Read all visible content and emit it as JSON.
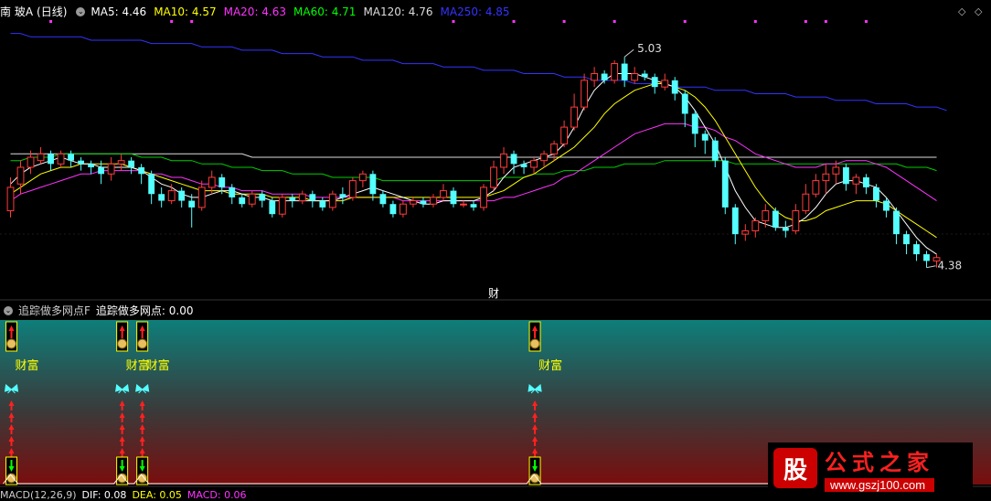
{
  "header": {
    "stock": "南 玻A",
    "period": "(日线)",
    "mas": [
      {
        "label": "MA5: 4.46",
        "color": "#ffffff"
      },
      {
        "label": "MA10: 4.57",
        "color": "#ffff00"
      },
      {
        "label": "MA20: 4.63",
        "color": "#ff33ff"
      },
      {
        "label": "MA60: 4.71",
        "color": "#00ff00"
      },
      {
        "label": "MA120: 4.76",
        "color": "#dddddd"
      },
      {
        "label": "MA250: 4.85",
        "color": "#3333ff"
      }
    ]
  },
  "indicator": {
    "name": "追踪做多网点F",
    "value_label": "追踪做多网点: 0.00",
    "signal_text": "财富"
  },
  "macd": {
    "label": "MACD(12,26,9)",
    "dif": "DIF: 0.08",
    "dea": "DEA: 0.05",
    "macd": "MACD: 0.06"
  },
  "chart_data": {
    "type": "candlestick",
    "annotations": {
      "high": "5.03",
      "low": "4.38",
      "event_marker": "财"
    },
    "y_range": [
      4.3,
      5.12
    ],
    "candles": [
      [
        4.55,
        4.62,
        4.53,
        4.65
      ],
      [
        4.63,
        4.68,
        4.6,
        4.7
      ],
      [
        4.68,
        4.71,
        4.66,
        4.73
      ],
      [
        4.7,
        4.72,
        4.69,
        4.74
      ],
      [
        4.72,
        4.69,
        4.67,
        4.73
      ],
      [
        4.69,
        4.72,
        4.68,
        4.73
      ],
      [
        4.72,
        4.7,
        4.68,
        4.73
      ],
      [
        4.7,
        4.69,
        4.67,
        4.71
      ],
      [
        4.69,
        4.68,
        4.66,
        4.7
      ],
      [
        4.68,
        4.66,
        4.63,
        4.7
      ],
      [
        4.66,
        4.69,
        4.64,
        4.71
      ],
      [
        4.69,
        4.7,
        4.67,
        4.72
      ],
      [
        4.7,
        4.68,
        4.66,
        4.71
      ],
      [
        4.68,
        4.66,
        4.63,
        4.69
      ],
      [
        4.66,
        4.6,
        4.57,
        4.67
      ],
      [
        4.6,
        4.58,
        4.56,
        4.62
      ],
      [
        4.58,
        4.61,
        4.57,
        4.63
      ],
      [
        4.61,
        4.58,
        4.56,
        4.62
      ],
      [
        4.58,
        4.56,
        4.5,
        4.6
      ],
      [
        4.56,
        4.62,
        4.55,
        4.64
      ],
      [
        4.62,
        4.65,
        4.6,
        4.67
      ],
      [
        4.65,
        4.62,
        4.6,
        4.66
      ],
      [
        4.62,
        4.59,
        4.57,
        4.63
      ],
      [
        4.59,
        4.57,
        4.56,
        4.6
      ],
      [
        4.57,
        4.6,
        4.56,
        4.61
      ],
      [
        4.6,
        4.58,
        4.56,
        4.61
      ],
      [
        4.58,
        4.54,
        4.53,
        4.59
      ],
      [
        4.54,
        4.59,
        4.53,
        4.6
      ],
      [
        4.59,
        4.58,
        4.56,
        4.6
      ],
      [
        4.58,
        4.6,
        4.57,
        4.61
      ],
      [
        4.6,
        4.58,
        4.56,
        4.61
      ],
      [
        4.58,
        4.56,
        4.55,
        4.59
      ],
      [
        4.56,
        4.6,
        4.55,
        4.61
      ],
      [
        4.6,
        4.59,
        4.57,
        4.62
      ],
      [
        4.59,
        4.64,
        4.58,
        4.65
      ],
      [
        4.64,
        4.66,
        4.62,
        4.67
      ],
      [
        4.66,
        4.6,
        4.58,
        4.67
      ],
      [
        4.6,
        4.57,
        4.56,
        4.61
      ],
      [
        4.57,
        4.54,
        4.53,
        4.58
      ],
      [
        4.54,
        4.57,
        4.53,
        4.58
      ],
      [
        4.57,
        4.58,
        4.56,
        4.59
      ],
      [
        4.58,
        4.57,
        4.56,
        4.59
      ],
      [
        4.57,
        4.59,
        4.56,
        4.6
      ],
      [
        4.59,
        4.61,
        4.58,
        4.63
      ],
      [
        4.61,
        4.57,
        4.56,
        4.62
      ],
      [
        4.57,
        4.57,
        4.56,
        4.58
      ],
      [
        4.57,
        4.56,
        4.55,
        4.58
      ],
      [
        4.56,
        4.62,
        4.55,
        4.63
      ],
      [
        4.62,
        4.68,
        4.61,
        4.7
      ],
      [
        4.68,
        4.72,
        4.66,
        4.74
      ],
      [
        4.72,
        4.69,
        4.66,
        4.73
      ],
      [
        4.69,
        4.68,
        4.66,
        4.7
      ],
      [
        4.68,
        4.7,
        4.66,
        4.71
      ],
      [
        4.7,
        4.72,
        4.68,
        4.73
      ],
      [
        4.72,
        4.75,
        4.7,
        4.76
      ],
      [
        4.75,
        4.8,
        4.74,
        4.82
      ],
      [
        4.8,
        4.86,
        4.79,
        4.9
      ],
      [
        4.86,
        4.94,
        4.85,
        4.96
      ],
      [
        4.94,
        4.96,
        4.92,
        4.98
      ],
      [
        4.96,
        4.94,
        4.93,
        4.97
      ],
      [
        4.94,
        4.99,
        4.93,
        5.0
      ],
      [
        4.99,
        4.94,
        4.92,
        5.01
      ],
      [
        4.94,
        4.96,
        4.93,
        4.98
      ],
      [
        4.96,
        4.95,
        4.94,
        4.97
      ],
      [
        4.95,
        4.92,
        4.9,
        4.96
      ],
      [
        4.92,
        4.94,
        4.91,
        4.96
      ],
      [
        4.94,
        4.9,
        4.88,
        4.95
      ],
      [
        4.9,
        4.84,
        4.8,
        4.91
      ],
      [
        4.84,
        4.78,
        4.74,
        4.85
      ],
      [
        4.78,
        4.76,
        4.72,
        4.79
      ],
      [
        4.76,
        4.7,
        4.68,
        4.77
      ],
      [
        4.7,
        4.56,
        4.54,
        4.71
      ],
      [
        4.56,
        4.48,
        4.45,
        4.57
      ],
      [
        4.48,
        4.49,
        4.46,
        4.51
      ],
      [
        4.49,
        4.52,
        4.47,
        4.53
      ],
      [
        4.52,
        4.55,
        4.5,
        4.57
      ],
      [
        4.55,
        4.5,
        4.49,
        4.56
      ],
      [
        4.5,
        4.49,
        4.47,
        4.52
      ],
      [
        4.49,
        4.55,
        4.48,
        4.57
      ],
      [
        4.55,
        4.6,
        4.54,
        4.63
      ],
      [
        4.6,
        4.64,
        4.59,
        4.66
      ],
      [
        4.64,
        4.66,
        4.6,
        4.69
      ],
      [
        4.66,
        4.68,
        4.63,
        4.7
      ],
      [
        4.68,
        4.63,
        4.61,
        4.69
      ],
      [
        4.63,
        4.65,
        4.6,
        4.66
      ],
      [
        4.65,
        4.62,
        4.6,
        4.66
      ],
      [
        4.62,
        4.58,
        4.56,
        4.63
      ],
      [
        4.58,
        4.55,
        4.53,
        4.59
      ],
      [
        4.55,
        4.48,
        4.45,
        4.56
      ],
      [
        4.48,
        4.45,
        4.42,
        4.49
      ],
      [
        4.45,
        4.42,
        4.4,
        4.46
      ],
      [
        4.42,
        4.4,
        4.38,
        4.43
      ],
      [
        4.4,
        4.41,
        4.38,
        4.42
      ]
    ],
    "ma5": [
      4.63,
      4.66,
      4.68,
      4.69,
      4.7,
      4.71,
      4.7,
      4.69,
      4.69,
      4.68,
      4.68,
      4.68,
      4.68,
      4.67,
      4.65,
      4.63,
      4.62,
      4.6,
      4.59,
      4.59,
      4.6,
      4.61,
      4.61,
      4.6,
      4.59,
      4.59,
      4.58,
      4.58,
      4.58,
      4.58,
      4.58,
      4.58,
      4.58,
      4.59,
      4.6,
      4.61,
      4.62,
      4.61,
      4.6,
      4.59,
      4.58,
      4.57,
      4.57,
      4.58,
      4.58,
      4.58,
      4.58,
      4.59,
      4.61,
      4.65,
      4.68,
      4.69,
      4.7,
      4.71,
      4.72,
      4.75,
      4.8,
      4.86,
      4.91,
      4.94,
      4.96,
      4.96,
      4.96,
      4.95,
      4.94,
      4.93,
      4.92,
      4.89,
      4.85,
      4.8,
      4.75,
      4.68,
      4.61,
      4.56,
      4.52,
      4.51,
      4.5,
      4.5,
      4.51,
      4.53,
      4.56,
      4.6,
      4.63,
      4.64,
      4.64,
      4.63,
      4.62,
      4.59,
      4.55,
      4.51,
      4.47,
      4.44,
      4.42
    ],
    "ma10": [
      4.6,
      4.62,
      4.64,
      4.66,
      4.67,
      4.68,
      4.68,
      4.69,
      4.69,
      4.69,
      4.69,
      4.69,
      4.68,
      4.67,
      4.66,
      4.65,
      4.64,
      4.63,
      4.62,
      4.61,
      4.61,
      4.61,
      4.6,
      4.6,
      4.6,
      4.6,
      4.59,
      4.59,
      4.59,
      4.59,
      4.58,
      4.58,
      4.58,
      4.58,
      4.59,
      4.59,
      4.59,
      4.59,
      4.59,
      4.59,
      4.59,
      4.59,
      4.59,
      4.59,
      4.59,
      4.59,
      4.59,
      4.59,
      4.6,
      4.61,
      4.63,
      4.65,
      4.66,
      4.68,
      4.7,
      4.72,
      4.74,
      4.77,
      4.8,
      4.84,
      4.87,
      4.89,
      4.91,
      4.92,
      4.93,
      4.93,
      4.92,
      4.91,
      4.89,
      4.86,
      4.82,
      4.77,
      4.72,
      4.67,
      4.62,
      4.58,
      4.55,
      4.53,
      4.52,
      4.52,
      4.53,
      4.55,
      4.56,
      4.57,
      4.58,
      4.58,
      4.58,
      4.57,
      4.55,
      4.53,
      4.51,
      4.49,
      4.47
    ],
    "ma20": [
      4.58,
      4.6,
      4.61,
      4.62,
      4.63,
      4.64,
      4.65,
      4.66,
      4.66,
      4.67,
      4.67,
      4.67,
      4.67,
      4.67,
      4.66,
      4.66,
      4.65,
      4.65,
      4.64,
      4.63,
      4.63,
      4.62,
      4.62,
      4.61,
      4.61,
      4.61,
      4.6,
      4.6,
      4.6,
      4.6,
      4.59,
      4.59,
      4.59,
      4.59,
      4.59,
      4.59,
      4.59,
      4.59,
      4.59,
      4.58,
      4.58,
      4.58,
      4.58,
      4.58,
      4.58,
      4.58,
      4.58,
      4.58,
      4.58,
      4.59,
      4.59,
      4.6,
      4.61,
      4.62,
      4.63,
      4.65,
      4.66,
      4.68,
      4.7,
      4.72,
      4.74,
      4.76,
      4.78,
      4.79,
      4.8,
      4.81,
      4.81,
      4.81,
      4.8,
      4.8,
      4.79,
      4.77,
      4.76,
      4.74,
      4.72,
      4.71,
      4.7,
      4.69,
      4.68,
      4.68,
      4.68,
      4.69,
      4.69,
      4.7,
      4.7,
      4.7,
      4.69,
      4.68,
      4.66,
      4.64,
      4.62,
      4.6,
      4.58
    ],
    "ma60": [
      4.7,
      4.7,
      4.71,
      4.71,
      4.71,
      4.72,
      4.72,
      4.72,
      4.72,
      4.72,
      4.72,
      4.72,
      4.72,
      4.71,
      4.71,
      4.71,
      4.7,
      4.7,
      4.7,
      4.69,
      4.69,
      4.69,
      4.68,
      4.68,
      4.68,
      4.67,
      4.67,
      4.67,
      4.66,
      4.66,
      4.66,
      4.66,
      4.65,
      4.65,
      4.65,
      4.65,
      4.65,
      4.64,
      4.64,
      4.64,
      4.64,
      4.64,
      4.64,
      4.64,
      4.64,
      4.64,
      4.64,
      4.64,
      4.64,
      4.65,
      4.65,
      4.65,
      4.66,
      4.66,
      4.66,
      4.67,
      4.67,
      4.67,
      4.68,
      4.68,
      4.68,
      4.69,
      4.69,
      4.69,
      4.69,
      4.7,
      4.7,
      4.7,
      4.7,
      4.7,
      4.7,
      4.7,
      4.69,
      4.69,
      4.69,
      4.69,
      4.69,
      4.69,
      4.69,
      4.69,
      4.69,
      4.69,
      4.69,
      4.69,
      4.69,
      4.69,
      4.69,
      4.69,
      4.69,
      4.68,
      4.68,
      4.68,
      4.67
    ],
    "ma120": [
      4.72,
      4.72,
      4.72,
      4.72,
      4.72,
      4.72,
      4.72,
      4.72,
      4.72,
      4.72,
      4.72,
      4.72,
      4.72,
      4.72,
      4.72,
      4.72,
      4.72,
      4.72,
      4.72,
      4.72,
      4.72,
      4.72,
      4.72,
      4.72,
      4.71,
      4.71,
      4.71,
      4.71,
      4.71,
      4.71,
      4.71,
      4.71,
      4.71,
      4.71,
      4.71,
      4.71,
      4.71,
      4.71,
      4.71,
      4.71,
      4.71,
      4.71,
      4.71,
      4.71,
      4.71,
      4.71,
      4.71,
      4.71,
      4.71,
      4.71,
      4.71,
      4.71,
      4.71,
      4.71,
      4.71,
      4.71,
      4.71,
      4.71,
      4.71,
      4.71,
      4.71,
      4.71,
      4.71,
      4.71,
      4.71,
      4.71,
      4.71,
      4.71,
      4.71,
      4.71,
      4.71,
      4.71,
      4.71,
      4.71,
      4.71,
      4.71,
      4.71,
      4.71,
      4.71,
      4.71,
      4.71,
      4.71,
      4.71,
      4.71,
      4.71,
      4.71,
      4.71,
      4.71,
      4.71,
      4.71,
      4.71,
      4.71,
      4.71
    ],
    "ma250": [
      5.08,
      5.08,
      5.07,
      5.07,
      5.07,
      5.07,
      5.07,
      5.07,
      5.06,
      5.06,
      5.06,
      5.06,
      5.06,
      5.06,
      5.05,
      5.05,
      5.05,
      5.05,
      5.05,
      5.04,
      5.04,
      5.04,
      5.04,
      5.03,
      5.03,
      5.03,
      5.03,
      5.02,
      5.02,
      5.02,
      5.02,
      5.01,
      5.01,
      5.01,
      5.01,
      5.0,
      5.0,
      5.0,
      5.0,
      4.99,
      4.99,
      4.99,
      4.99,
      4.98,
      4.98,
      4.98,
      4.98,
      4.97,
      4.97,
      4.97,
      4.97,
      4.96,
      4.96,
      4.96,
      4.96,
      4.95,
      4.95,
      4.95,
      4.94,
      4.94,
      4.94,
      4.94,
      4.93,
      4.93,
      4.93,
      4.93,
      4.92,
      4.92,
      4.92,
      4.92,
      4.91,
      4.91,
      4.91,
      4.91,
      4.9,
      4.9,
      4.9,
      4.9,
      4.89,
      4.89,
      4.89,
      4.89,
      4.88,
      4.88,
      4.88,
      4.88,
      4.87,
      4.87,
      4.87,
      4.87,
      4.86,
      4.86,
      4.86,
      4.85
    ],
    "signals": [
      0,
      11,
      13,
      52
    ],
    "top_markers": [
      4,
      16,
      18,
      44,
      50,
      55,
      60,
      67,
      74,
      79,
      81,
      85
    ]
  }
}
